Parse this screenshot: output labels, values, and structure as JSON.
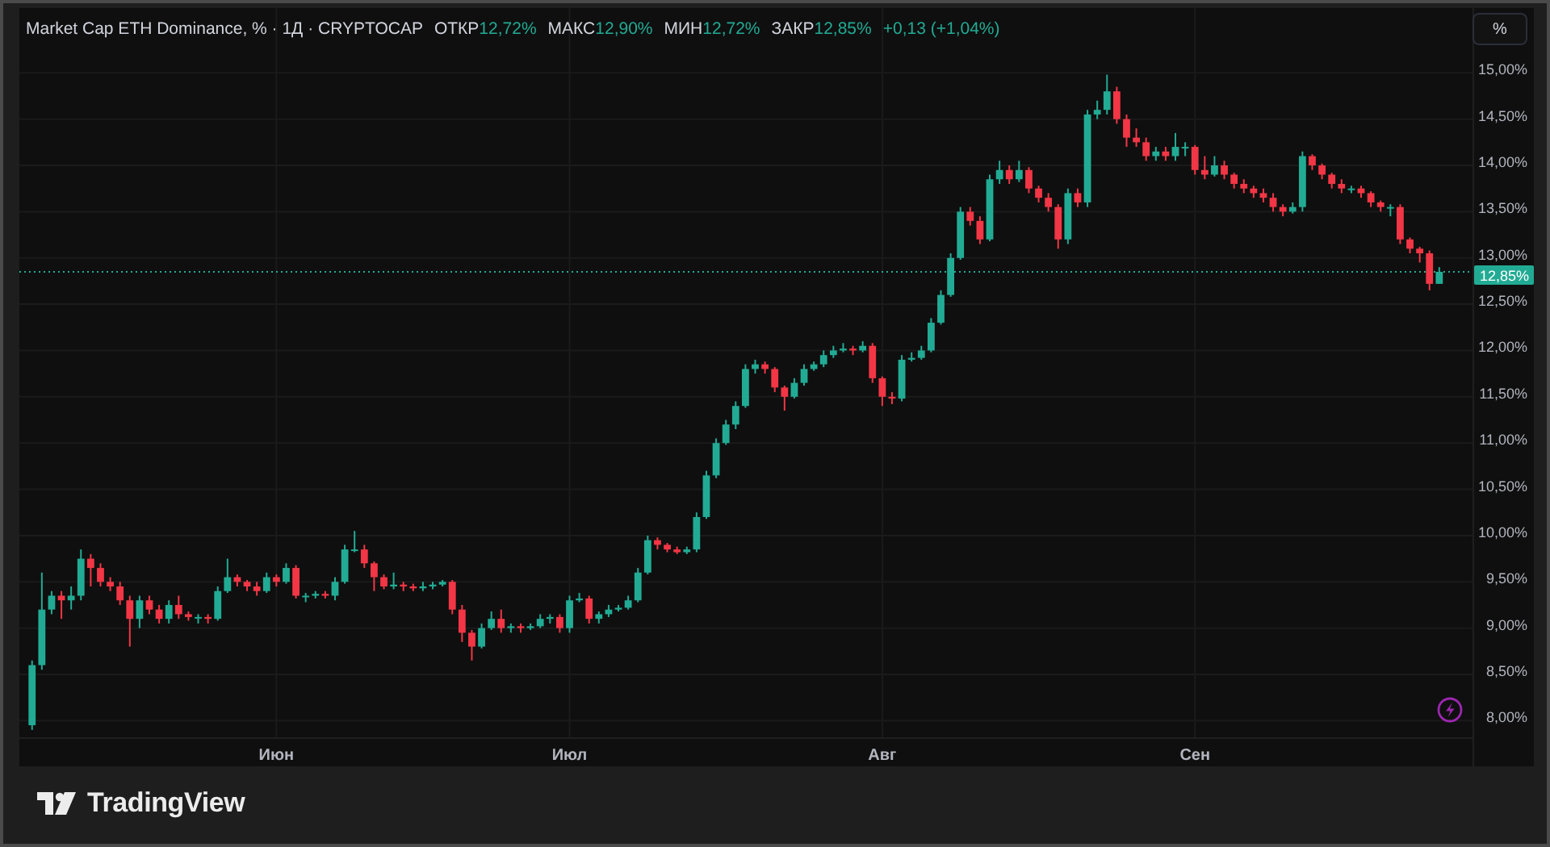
{
  "legend": {
    "title": "Market Cap ETH Dominance, % · 1Д · CRYPTOCAP",
    "stats": [
      {
        "label": "ОТКР",
        "value": "12,72%"
      },
      {
        "label": "МАКС",
        "value": "12,90%"
      },
      {
        "label": "МИН",
        "value": "12,72%"
      },
      {
        "label": "ЗАКР",
        "value": "12,85%"
      }
    ],
    "change": "+0,13 (+1,04%)"
  },
  "scale_button": "%",
  "chart": {
    "chart_data": {
      "type": "candlestick",
      "ylim": [
        7.82,
        15.7
      ],
      "grid": true,
      "ref_lines": [
        {
          "axis": "y",
          "value": 12.85,
          "label": "12,85%",
          "color": "#22ab94"
        }
      ],
      "yticks": [
        {
          "value": 15,
          "label": "15,00%"
        },
        {
          "value": 14.5,
          "label": "14,50%"
        },
        {
          "value": 14,
          "label": "14,00%"
        },
        {
          "value": 13.5,
          "label": "13,50%"
        },
        {
          "value": 13,
          "label": "13,00%"
        },
        {
          "value": 12.5,
          "label": "12,50%"
        },
        {
          "value": 12,
          "label": "12,00%"
        },
        {
          "value": 11.5,
          "label": "11,50%"
        },
        {
          "value": 11,
          "label": "11,00%"
        },
        {
          "value": 10.5,
          "label": "10,50%"
        },
        {
          "value": 10,
          "label": "10,00%"
        },
        {
          "value": 9.5,
          "label": "9,50%"
        },
        {
          "value": 9,
          "label": "9,00%"
        },
        {
          "value": 8.5,
          "label": "8,50%"
        },
        {
          "value": 8,
          "label": "8,00%"
        }
      ],
      "categories": [
        null,
        null,
        null,
        null,
        null,
        null,
        null,
        null,
        null,
        null,
        null,
        null,
        null,
        null,
        null,
        null,
        null,
        null,
        null,
        null,
        null,
        null,
        null,
        null,
        null,
        "Июн",
        null,
        null,
        null,
        null,
        null,
        null,
        null,
        null,
        null,
        null,
        null,
        null,
        null,
        null,
        null,
        null,
        null,
        null,
        null,
        null,
        null,
        null,
        null,
        null,
        null,
        null,
        null,
        null,
        null,
        "Июл",
        null,
        null,
        null,
        null,
        null,
        null,
        null,
        null,
        null,
        null,
        null,
        null,
        null,
        null,
        null,
        null,
        null,
        null,
        null,
        null,
        null,
        null,
        null,
        null,
        null,
        null,
        null,
        null,
        null,
        null,
        null,
        "Авг",
        null,
        null,
        null,
        null,
        null,
        null,
        null,
        null,
        null,
        null,
        null,
        null,
        null,
        null,
        null,
        null,
        null,
        null,
        null,
        null,
        null,
        null,
        null,
        null,
        null,
        null,
        null,
        null,
        null,
        null,
        null,
        "Сен",
        null,
        null,
        null,
        null,
        null,
        null,
        null,
        null,
        null,
        null,
        null,
        null,
        null,
        null,
        null,
        null,
        null,
        null,
        null,
        null,
        null,
        null,
        null,
        null,
        null
      ],
      "ohlc": [
        [
          7.95,
          8.65,
          7.9,
          8.6
        ],
        [
          8.6,
          9.6,
          8.55,
          9.2
        ],
        [
          9.2,
          9.4,
          9.15,
          9.35
        ],
        [
          9.35,
          9.4,
          9.1,
          9.3
        ],
        [
          9.3,
          9.45,
          9.2,
          9.35
        ],
        [
          9.35,
          9.85,
          9.3,
          9.75
        ],
        [
          9.75,
          9.8,
          9.45,
          9.65
        ],
        [
          9.65,
          9.7,
          9.45,
          9.5
        ],
        [
          9.5,
          9.55,
          9.4,
          9.45
        ],
        [
          9.45,
          9.5,
          9.25,
          9.3
        ],
        [
          9.3,
          9.35,
          8.8,
          9.1
        ],
        [
          9.1,
          9.35,
          9.0,
          9.3
        ],
        [
          9.3,
          9.35,
          9.15,
          9.2
        ],
        [
          9.2,
          9.25,
          9.05,
          9.1
        ],
        [
          9.1,
          9.3,
          9.05,
          9.25
        ],
        [
          9.25,
          9.35,
          9.1,
          9.15
        ],
        [
          9.15,
          9.18,
          9.08,
          9.12
        ],
        [
          9.12,
          9.15,
          9.05,
          9.12
        ],
        [
          9.12,
          9.15,
          9.05,
          9.1
        ],
        [
          9.1,
          9.45,
          9.08,
          9.4
        ],
        [
          9.4,
          9.75,
          9.38,
          9.55
        ],
        [
          9.55,
          9.58,
          9.45,
          9.5
        ],
        [
          9.5,
          9.52,
          9.4,
          9.45
        ],
        [
          9.45,
          9.5,
          9.35,
          9.4
        ],
        [
          9.4,
          9.6,
          9.38,
          9.55
        ],
        [
          9.55,
          9.58,
          9.45,
          9.5
        ],
        [
          9.5,
          9.7,
          9.48,
          9.65
        ],
        [
          9.65,
          9.68,
          9.32,
          9.35
        ],
        [
          9.35,
          9.38,
          9.28,
          9.35
        ],
        [
          9.35,
          9.4,
          9.32,
          9.37
        ],
        [
          9.37,
          9.4,
          9.32,
          9.35
        ],
        [
          9.35,
          9.55,
          9.3,
          9.5
        ],
        [
          9.5,
          9.9,
          9.48,
          9.85
        ],
        [
          9.85,
          10.05,
          9.82,
          9.85
        ],
        [
          9.85,
          9.9,
          9.65,
          9.7
        ],
        [
          9.7,
          9.72,
          9.4,
          9.55
        ],
        [
          9.55,
          9.58,
          9.42,
          9.45
        ],
        [
          9.45,
          9.6,
          9.42,
          9.47
        ],
        [
          9.47,
          9.5,
          9.4,
          9.45
        ],
        [
          9.45,
          9.48,
          9.4,
          9.43
        ],
        [
          9.43,
          9.5,
          9.4,
          9.45
        ],
        [
          9.45,
          9.5,
          9.42,
          9.47
        ],
        [
          9.47,
          9.52,
          9.45,
          9.5
        ],
        [
          9.5,
          9.52,
          9.15,
          9.2
        ],
        [
          9.2,
          9.25,
          8.85,
          8.95
        ],
        [
          8.95,
          8.98,
          8.65,
          8.8
        ],
        [
          8.8,
          9.05,
          8.78,
          9.0
        ],
        [
          9.0,
          9.18,
          8.98,
          9.1
        ],
        [
          9.1,
          9.2,
          8.95,
          9.0
        ],
        [
          9.0,
          9.05,
          8.95,
          9.02
        ],
        [
          9.02,
          9.05,
          8.95,
          9.0
        ],
        [
          9.0,
          9.05,
          8.98,
          9.02
        ],
        [
          9.02,
          9.15,
          9.0,
          9.1
        ],
        [
          9.1,
          9.15,
          9.05,
          9.12
        ],
        [
          9.12,
          9.15,
          8.95,
          9.0
        ],
        [
          9.0,
          9.35,
          8.95,
          9.3
        ],
        [
          9.3,
          9.38,
          9.28,
          9.32
        ],
        [
          9.32,
          9.35,
          9.05,
          9.1
        ],
        [
          9.1,
          9.18,
          9.05,
          9.15
        ],
        [
          9.15,
          9.25,
          9.12,
          9.2
        ],
        [
          9.2,
          9.25,
          9.18,
          9.22
        ],
        [
          9.22,
          9.35,
          9.2,
          9.3
        ],
        [
          9.3,
          9.65,
          9.28,
          9.6
        ],
        [
          9.6,
          10.0,
          9.58,
          9.95
        ],
        [
          9.95,
          9.98,
          9.85,
          9.9
        ],
        [
          9.9,
          9.92,
          9.82,
          9.85
        ],
        [
          9.85,
          9.88,
          9.8,
          9.82
        ],
        [
          9.82,
          9.88,
          9.8,
          9.85
        ],
        [
          9.85,
          10.25,
          9.82,
          10.2
        ],
        [
          10.2,
          10.7,
          10.18,
          10.65
        ],
        [
          10.65,
          11.05,
          10.62,
          11.0
        ],
        [
          11.0,
          11.25,
          10.98,
          11.2
        ],
        [
          11.2,
          11.45,
          11.15,
          11.4
        ],
        [
          11.4,
          11.85,
          11.38,
          11.8
        ],
        [
          11.8,
          11.9,
          11.75,
          11.85
        ],
        [
          11.85,
          11.88,
          11.75,
          11.8
        ],
        [
          11.8,
          11.82,
          11.55,
          11.6
        ],
        [
          11.6,
          11.62,
          11.35,
          11.5
        ],
        [
          11.5,
          11.7,
          11.48,
          11.65
        ],
        [
          11.65,
          11.85,
          11.62,
          11.8
        ],
        [
          11.8,
          11.88,
          11.78,
          11.85
        ],
        [
          11.85,
          12.0,
          11.82,
          11.95
        ],
        [
          11.95,
          12.05,
          11.92,
          12.0
        ],
        [
          12.0,
          12.08,
          11.98,
          12.02
        ],
        [
          12.02,
          12.05,
          11.95,
          12.0
        ],
        [
          12.0,
          12.1,
          11.98,
          12.05
        ],
        [
          12.05,
          12.08,
          11.65,
          11.7
        ],
        [
          11.7,
          11.72,
          11.4,
          11.5
        ],
        [
          11.5,
          11.55,
          11.42,
          11.48
        ],
        [
          11.48,
          11.95,
          11.45,
          11.9
        ],
        [
          11.9,
          11.98,
          11.88,
          11.92
        ],
        [
          11.92,
          12.05,
          11.9,
          12.0
        ],
        [
          12.0,
          12.35,
          11.98,
          12.3
        ],
        [
          12.3,
          12.65,
          12.28,
          12.6
        ],
        [
          12.6,
          13.05,
          12.58,
          13.0
        ],
        [
          13.0,
          13.55,
          12.98,
          13.5
        ],
        [
          13.5,
          13.55,
          13.35,
          13.4
        ],
        [
          13.4,
          13.45,
          13.15,
          13.2
        ],
        [
          13.2,
          13.9,
          13.18,
          13.85
        ],
        [
          13.85,
          14.05,
          13.8,
          13.95
        ],
        [
          13.95,
          14.0,
          13.8,
          13.85
        ],
        [
          13.85,
          14.05,
          13.82,
          13.95
        ],
        [
          13.95,
          13.98,
          13.7,
          13.75
        ],
        [
          13.75,
          13.78,
          13.6,
          13.65
        ],
        [
          13.65,
          13.7,
          13.5,
          13.55
        ],
        [
          13.55,
          13.58,
          13.1,
          13.2
        ],
        [
          13.2,
          13.75,
          13.15,
          13.7
        ],
        [
          13.7,
          13.75,
          13.55,
          13.6
        ],
        [
          13.6,
          14.6,
          13.55,
          14.55
        ],
        [
          14.55,
          14.7,
          14.5,
          14.6
        ],
        [
          14.6,
          14.98,
          14.55,
          14.8
        ],
        [
          14.8,
          14.85,
          14.45,
          14.5
        ],
        [
          14.5,
          14.55,
          14.2,
          14.3
        ],
        [
          14.3,
          14.4,
          14.2,
          14.25
        ],
        [
          14.25,
          14.3,
          14.05,
          14.1
        ],
        [
          14.1,
          14.2,
          14.05,
          14.15
        ],
        [
          14.15,
          14.2,
          14.05,
          14.1
        ],
        [
          14.1,
          14.35,
          14.05,
          14.2
        ],
        [
          14.2,
          14.25,
          14.1,
          14.2
        ],
        [
          14.2,
          14.22,
          13.9,
          13.95
        ],
        [
          13.95,
          14.1,
          13.85,
          13.9
        ],
        [
          13.9,
          14.1,
          13.88,
          14.0
        ],
        [
          14.0,
          14.05,
          13.85,
          13.9
        ],
        [
          13.9,
          13.92,
          13.75,
          13.8
        ],
        [
          13.8,
          13.85,
          13.7,
          13.75
        ],
        [
          13.75,
          13.78,
          13.65,
          13.7
        ],
        [
          13.7,
          13.75,
          13.6,
          13.65
        ],
        [
          13.65,
          13.7,
          13.5,
          13.55
        ],
        [
          13.55,
          13.58,
          13.45,
          13.5
        ],
        [
          13.5,
          13.6,
          13.48,
          13.55
        ],
        [
          13.55,
          14.15,
          13.5,
          14.1
        ],
        [
          14.1,
          14.12,
          13.95,
          14.0
        ],
        [
          14.0,
          14.02,
          13.85,
          13.9
        ],
        [
          13.9,
          13.92,
          13.75,
          13.8
        ],
        [
          13.8,
          13.85,
          13.7,
          13.75
        ],
        [
          13.75,
          13.78,
          13.7,
          13.75
        ],
        [
          13.75,
          13.78,
          13.65,
          13.7
        ],
        [
          13.7,
          13.72,
          13.55,
          13.6
        ],
        [
          13.6,
          13.62,
          13.5,
          13.55
        ],
        [
          13.55,
          13.58,
          13.45,
          13.55
        ],
        [
          13.55,
          13.58,
          13.15,
          13.2
        ],
        [
          13.2,
          13.22,
          13.05,
          13.1
        ],
        [
          13.1,
          13.12,
          12.95,
          13.05
        ],
        [
          13.05,
          13.08,
          12.65,
          12.72
        ],
        [
          12.72,
          12.9,
          12.72,
          12.85
        ]
      ]
    }
  },
  "footer": {
    "logo_text": "TradingView"
  }
}
